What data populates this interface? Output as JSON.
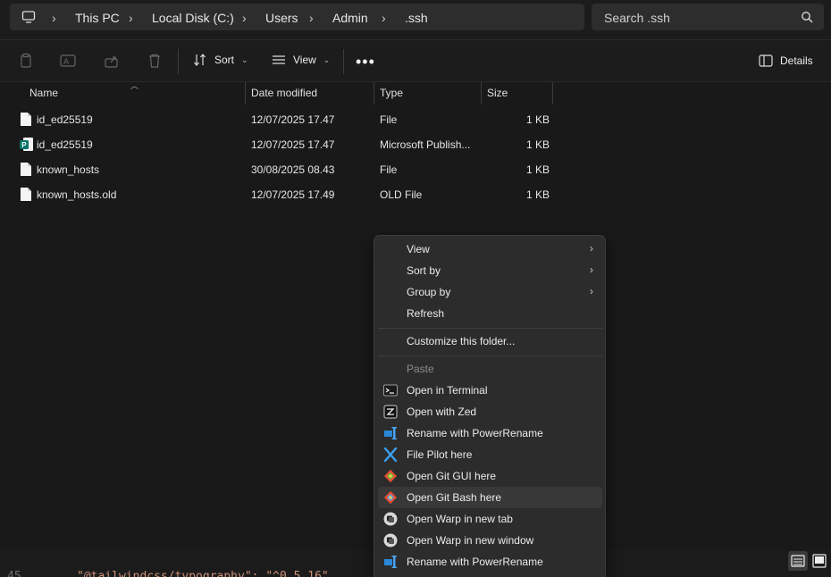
{
  "breadcrumb": [
    "This PC",
    "Local Disk (C:)",
    "Users",
    "Admin",
    ".ssh"
  ],
  "search": {
    "placeholder": "Search .ssh"
  },
  "toolbar": {
    "sort_label": "Sort",
    "view_label": "View",
    "more_label": "•••",
    "details_label": "Details"
  },
  "columns": {
    "name": "Name",
    "date": "Date modified",
    "type": "Type",
    "size": "Size"
  },
  "files": [
    {
      "name": "id_ed25519",
      "date": "12/07/2025 17.47",
      "type": "File",
      "size": "1 KB",
      "icon": "generic-file-icon"
    },
    {
      "name": "id_ed25519",
      "date": "12/07/2025 17.47",
      "type": "Microsoft Publish...",
      "size": "1 KB",
      "icon": "publisher-file-icon"
    },
    {
      "name": "known_hosts",
      "date": "30/08/2025 08.43",
      "type": "File",
      "size": "1 KB",
      "icon": "generic-file-icon"
    },
    {
      "name": "known_hosts.old",
      "date": "12/07/2025 17.49",
      "type": "OLD File",
      "size": "1 KB",
      "icon": "generic-file-icon"
    }
  ],
  "context_menu": {
    "view": "View",
    "sort_by": "Sort by",
    "group_by": "Group by",
    "refresh": "Refresh",
    "customize": "Customize this folder...",
    "paste": "Paste",
    "open_terminal": "Open in Terminal",
    "open_zed": "Open with Zed",
    "rename_power_1": "Rename with PowerRename",
    "file_pilot": "File Pilot here",
    "git_gui": "Open Git GUI here",
    "git_bash": "Open Git Bash here",
    "warp_tab": "Open Warp in new tab",
    "warp_window": "Open Warp in new window",
    "rename_power_2": "Rename with PowerRename"
  },
  "editor_behind": {
    "line_number": "45",
    "text": "\"@tailwindcss/typography\": \"^0.5.16\""
  },
  "colors": {
    "background": "#191919",
    "menu": "#2c2c2c",
    "accent_blue": "#4a9fe8"
  }
}
